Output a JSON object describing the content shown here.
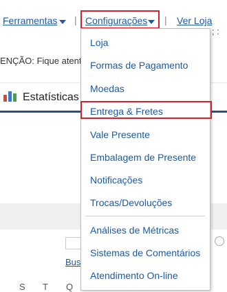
{
  "topnav": {
    "ferramentas_label": "Ferramentas",
    "configuracoes_label": "Configurações",
    "ver_loja_label": "Ver Loja",
    "separator": "|",
    "partial_right": "; :"
  },
  "notice": {
    "text": "ENÇÃO: Fique atent"
  },
  "stats": {
    "label": "Estatísticas"
  },
  "dropdown": {
    "items": [
      "Loja",
      "Formas de Pagamento",
      "Moedas",
      "Entrega & Fretes",
      "Vale Presente",
      "Embalagem de Presente",
      "Notificações",
      "Trocas/Devoluções",
      "Análises de Métricas",
      "Sistemas de Comentários",
      "Atendimento On-line"
    ]
  },
  "background": {
    "bus_label": "Bus",
    "weekdays": [
      "S",
      "T",
      "Q"
    ]
  },
  "colors": {
    "link": "#1a5aa8",
    "highlight": "#d3202c",
    "stats_border": "#2c4f7a"
  }
}
